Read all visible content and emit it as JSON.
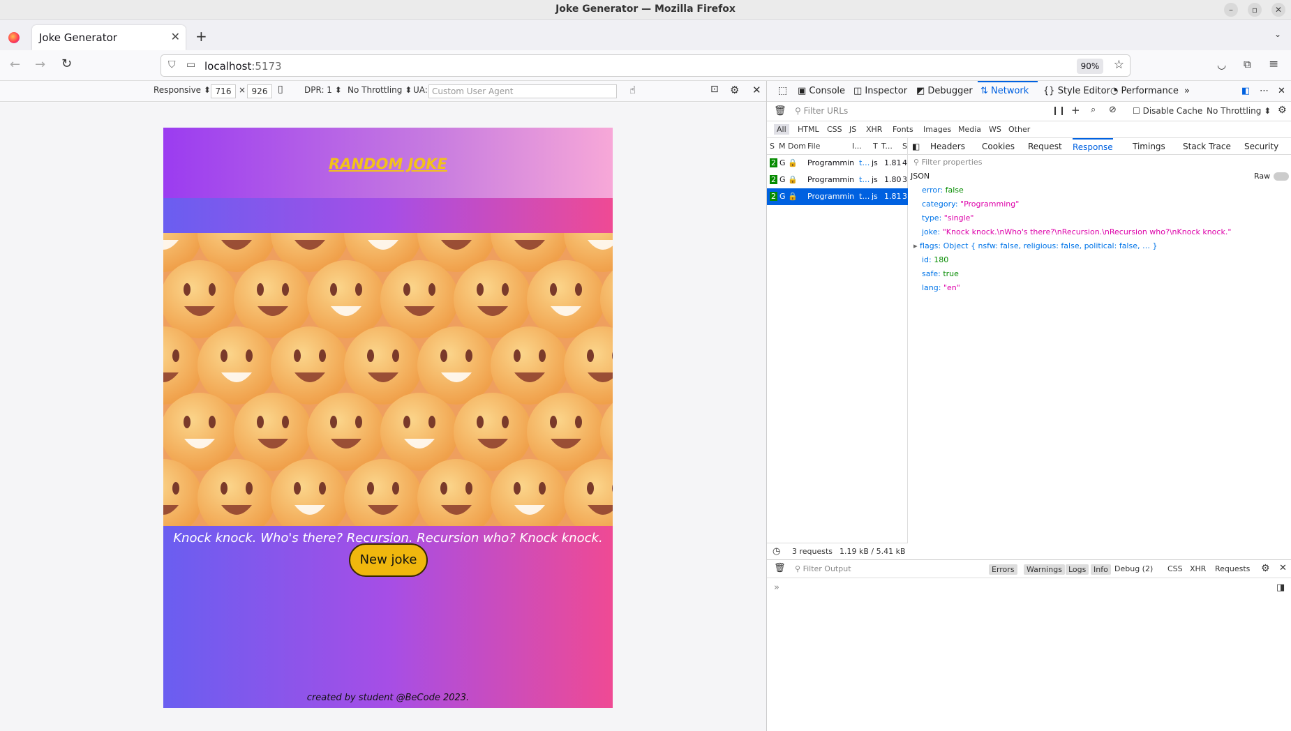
{
  "window": {
    "title": "Joke Generator — Mozilla Firefox"
  },
  "tab": {
    "title": "Joke Generator"
  },
  "url": {
    "host": "localhost",
    "port": ":5173",
    "zoom": "90%"
  },
  "rdm": {
    "device": "Responsive",
    "width": "716",
    "height": "926",
    "dpr": "DPR: 1",
    "throttling": "No Throttling",
    "ua_label": "UA:",
    "ua_placeholder": "Custom User Agent"
  },
  "app": {
    "title": "RANDOM JOKE",
    "joke": "Knock knock. Who's there? Recursion. Recursion who? Knock knock.",
    "button": "New joke",
    "footer": "created by student @BeCode 2023."
  },
  "devtools": {
    "tabs": [
      "Console",
      "Inspector",
      "Debugger",
      "Network",
      "Style Editor",
      "Performance"
    ],
    "active_tab": "Network",
    "filter_placeholder": "Filter URLs",
    "disable_cache": "Disable Cache",
    "throttling": "No Throttling",
    "types": [
      "All",
      "HTML",
      "CSS",
      "JS",
      "XHR",
      "Fonts",
      "Images",
      "Media",
      "WS",
      "Other"
    ],
    "columns": [
      "S",
      "M",
      "Dom",
      "File",
      "I...",
      "T",
      "T...",
      "S"
    ],
    "requests": [
      {
        "status": "2",
        "method": "G",
        "file": "Programmin",
        "type": "js",
        "transferred": "1.81",
        "size": "4"
      },
      {
        "status": "2",
        "method": "G",
        "file": "Programmin",
        "type": "js",
        "transferred": "1.80",
        "size": "3"
      },
      {
        "status": "2",
        "method": "G",
        "file": "Programmin",
        "type": "js",
        "transferred": "1.81",
        "size": "3"
      }
    ],
    "summary_count": "3 requests",
    "summary_size": "1.19 kB / 5.41 kB",
    "detail_tabs": [
      "Headers",
      "Cookies",
      "Request",
      "Response",
      "Timings",
      "Stack Trace",
      "Security"
    ],
    "active_detail": "Response",
    "filter_properties": "Filter properties",
    "json_label": "JSON",
    "raw_label": "Raw",
    "json": {
      "error": "false",
      "category": "\"Programming\"",
      "type": "\"single\"",
      "joke": "\"Knock knock.\\nWho's there?\\nRecursion.\\nRecursion who?\\nKnock knock.\"",
      "flags": "Object { nsfw: false, religious: false, political: false, … }",
      "id": "180",
      "safe": "true",
      "lang": "\"en\""
    },
    "console": {
      "filter_placeholder": "Filter Output",
      "levels": [
        "Errors",
        "Warnings",
        "Logs",
        "Info",
        "Debug (2)"
      ],
      "extras": [
        "CSS",
        "XHR",
        "Requests"
      ]
    }
  },
  "colors": {
    "accent": "#0061e0",
    "button": "#f0b70e",
    "title": "#f2c21a"
  }
}
